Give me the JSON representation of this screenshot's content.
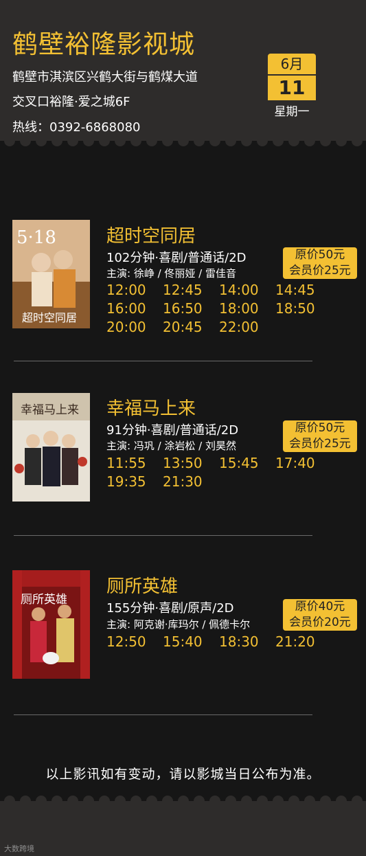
{
  "cinema": {
    "name": "鹤壁裕隆影视城",
    "address_line1": "鹤壁市淇滨区兴鹤大街与鹤煤大道",
    "address_line2": "交叉口裕隆·爱之城6F",
    "hotline": "热线：0392-6868080"
  },
  "date": {
    "month": "6月",
    "day": "11",
    "weekday": "星期一"
  },
  "movies": [
    {
      "title": "超时空同居",
      "info": "102分钟·喜剧/普通话/2D",
      "cast": "主演: 徐峥 / 佟丽娅 / 雷佳音",
      "price_original": "原价50元",
      "price_member": "会员价25元",
      "poster_text": "超时空同居",
      "poster_badge": "5·18",
      "showtimes": [
        "12:00",
        "12:45",
        "14:00",
        "14:45",
        "16:00",
        "16:50",
        "18:00",
        "18:50",
        "20:00",
        "20:45",
        "22:00"
      ]
    },
    {
      "title": "幸福马上来",
      "info": "91分钟·喜剧/普通话/2D",
      "cast": "主演: 冯巩 / 涂岩松 / 刘昊然",
      "price_original": "原价50元",
      "price_member": "会员价25元",
      "poster_text": "幸福马上来",
      "showtimes": [
        "11:55",
        "13:50",
        "15:45",
        "17:40",
        "19:35",
        "21:30"
      ]
    },
    {
      "title": "厕所英雄",
      "info": "155分钟·喜剧/原声/2D",
      "cast": "主演: 阿克谢·库玛尔 / 佩德卡尔",
      "price_original": "原价40元",
      "price_member": "会员价20元",
      "poster_text": "厕所英雄",
      "showtimes": [
        "12:50",
        "15:40",
        "18:30",
        "21:20"
      ]
    }
  ],
  "notice": "以上影讯如有变动，请以影城当日公布为准。",
  "watermark": "大数跨境",
  "colors": {
    "accent": "#f3c033",
    "header_bg": "#2e2c2b",
    "body_bg": "#161616"
  }
}
